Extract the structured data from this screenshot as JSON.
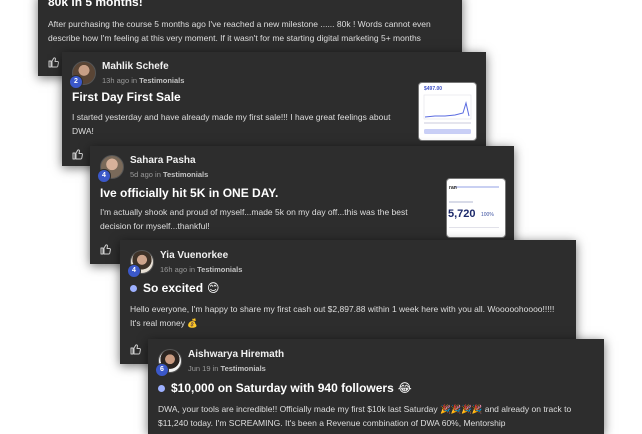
{
  "posts": [
    {
      "title": "80k in 5 months!",
      "body": "After purchasing the course 5 months ago I've reached a new milestone ...... 80k ! Words cannot even describe how I'm feeling at this very moment. If it wasn't for me starting digital marketing 5+ months"
    },
    {
      "author": "Mahlik Schefe",
      "level": "2",
      "time": "13h ago in",
      "category": "Testimonials",
      "title": "First Day First Sale",
      "body": "I started yesterday and have already made my first sale!!! I have great feelings about DWA!",
      "thumb_value": "$497.00"
    },
    {
      "author": "Sahara Pasha",
      "level": "4",
      "time": "5d ago in",
      "category": "Testimonials",
      "title": "Ive officially hit 5K in ONE DAY.",
      "body": "I'm actually shook and proud of myself...made 5k on my day off...this was the best decision for myself...thankful!",
      "thumb_value": "5,720",
      "thumb_pct": "100%"
    },
    {
      "author": "Yia Vuenorkee",
      "level": "4",
      "time": "16h ago in",
      "category": "Testimonials",
      "title": "So excited",
      "title_emoji": "😊",
      "body": "Hello everyone, I'm happy to share my first cash out $2,897.88 within 1 week here with you all. Wooooohoooo!!!!! It's real money 💰"
    },
    {
      "author": "Aishwarya Hiremath",
      "level": "6",
      "time": "Jun 19 in",
      "category": "Testimonials",
      "title": "$10,000 on Saturday with 940 followers",
      "title_emoji": "😂",
      "body": "DWA, your tools are incredible!! Officially made my first $10k last Saturday 🎉🎉🎉🎉 and already on track to $11,240 today. I'm SCREAMING. It's been a Revenue combination of DWA 60%, Mentorship"
    }
  ],
  "colors": {
    "card_bg": "#2d2d2d",
    "level_badge": "#3b58c9",
    "title_dot": "#9db0ff"
  },
  "icons": {
    "like": "thumbs-up-icon"
  }
}
